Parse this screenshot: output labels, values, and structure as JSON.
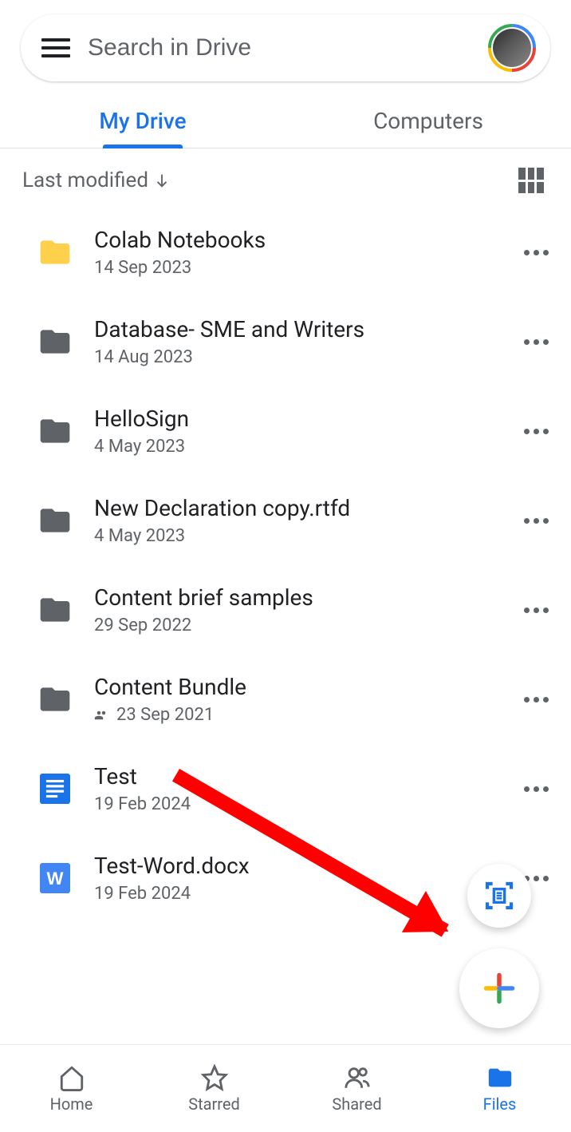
{
  "search": {
    "placeholder": "Search in Drive"
  },
  "tabs": [
    {
      "label": "My Drive",
      "active": true
    },
    {
      "label": "Computers",
      "active": false
    }
  ],
  "sort": {
    "label": "Last modified"
  },
  "files": [
    {
      "name": "Colab Notebooks",
      "date": "14 Sep 2023",
      "type": "folder",
      "color": "#ffd04c",
      "shared": false
    },
    {
      "name": "Database- SME and Writers",
      "date": "14 Aug 2023",
      "type": "folder",
      "color": "#5f6368",
      "shared": false
    },
    {
      "name": "HelloSign",
      "date": "4 May 2023",
      "type": "folder",
      "color": "#5f6368",
      "shared": false
    },
    {
      "name": "New Declaration copy.rtfd",
      "date": "4 May 2023",
      "type": "folder",
      "color": "#5f6368",
      "shared": false
    },
    {
      "name": "Content brief samples",
      "date": "29 Sep 2022",
      "type": "folder",
      "color": "#5f6368",
      "shared": false
    },
    {
      "name": "Content Bundle",
      "date": "23 Sep 2021",
      "type": "folder",
      "color": "#5f6368",
      "shared": true
    },
    {
      "name": "Test",
      "date": "19 Feb 2024",
      "type": "gdoc",
      "color": "#1a73e8",
      "shared": false
    },
    {
      "name": "Test-Word.docx",
      "date": "19 Feb 2024",
      "type": "word",
      "color": "#4285f4",
      "shared": false
    }
  ],
  "nav": [
    {
      "label": "Home",
      "icon": "home",
      "active": false
    },
    {
      "label": "Starred",
      "icon": "star",
      "active": false
    },
    {
      "label": "Shared",
      "icon": "shared",
      "active": false
    },
    {
      "label": "Files",
      "icon": "files",
      "active": true
    }
  ]
}
